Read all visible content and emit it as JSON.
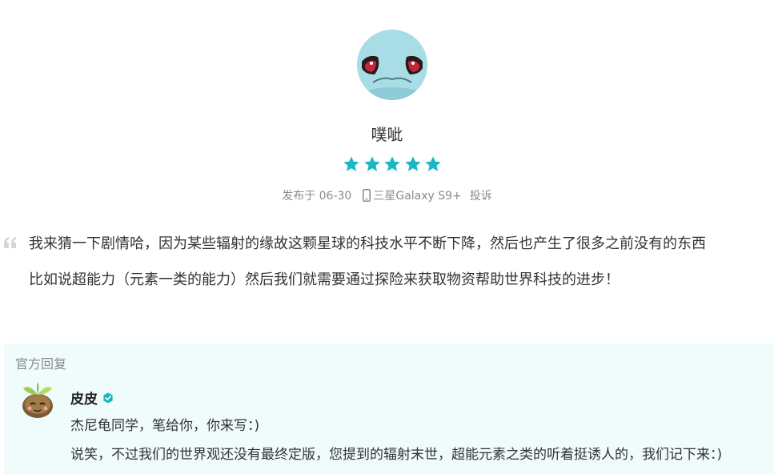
{
  "review": {
    "username": "噗呲",
    "rating": 5,
    "rating_max": 5,
    "date_label": "发布于 06-30",
    "device": "三星Galaxy S9+",
    "report_label": "投诉",
    "paragraphs": [
      "我来猜一下剧情哈，因为某些辐射的缘故这颗星球的科技水平不断下降，然后也产生了很多之前没有的东西",
      "比如说超能力（元素一类的能力）然后我们就需要通过探险来获取物资帮助世界科技的进步！"
    ]
  },
  "official_reply": {
    "label": "官方回复",
    "dev_name": "皮皮",
    "paragraphs": [
      "杰尼龟同学，笔给你，你来写：)",
      "说笑，不过我们的世界观还没有最终定版，您提到的辐射末世，超能元素之类的听着挺诱人的，我们记下来：)"
    ]
  },
  "colors": {
    "star": "#19b8c2",
    "reply_bg": "#f0fbfb",
    "verified": "#16b6c0",
    "meta_text": "#8a8a8a"
  },
  "icons": {
    "avatar": "squirtle-avatar",
    "dev_avatar": "sprout-avatar",
    "device": "phone-icon",
    "quote": "quote-icon",
    "verified": "verified-check-icon"
  }
}
